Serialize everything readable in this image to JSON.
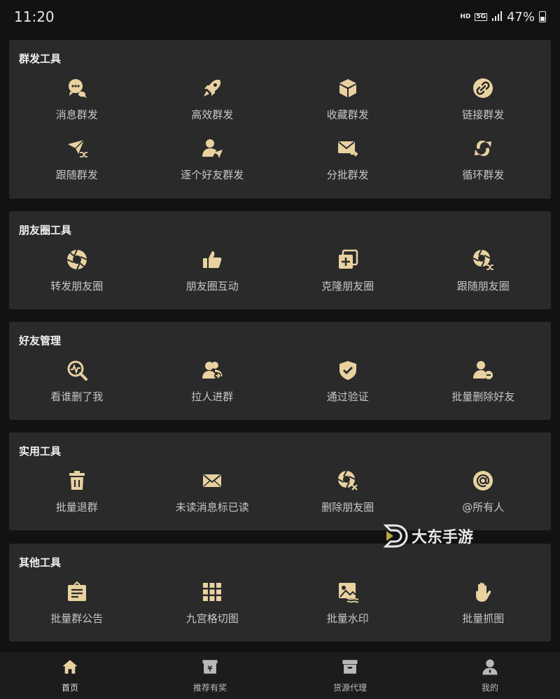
{
  "status": {
    "time": "11:20",
    "hd": "HD",
    "network": "5G",
    "battery": "47%"
  },
  "colors": {
    "accent": "#e9d2a0",
    "card": "#2a2a2b",
    "background": "#121212"
  },
  "sections": [
    {
      "title": "群发工具",
      "items": [
        {
          "label": "消息群发",
          "icon": "chat-bubbles-icon"
        },
        {
          "label": "高效群发",
          "icon": "rocket-icon"
        },
        {
          "label": "收藏群发",
          "icon": "box-icon"
        },
        {
          "label": "链接群发",
          "icon": "link-icon"
        },
        {
          "label": "跟随群发",
          "icon": "paper-plane-shuffle-icon"
        },
        {
          "label": "逐个好友群发",
          "icon": "user-send-icon"
        },
        {
          "label": "分批群发",
          "icon": "mail-forward-icon"
        },
        {
          "label": "循环群发",
          "icon": "loop-arrows-icon"
        }
      ]
    },
    {
      "title": "朋友圈工具",
      "items": [
        {
          "label": "转发朋友圈",
          "icon": "aperture-icon"
        },
        {
          "label": "朋友圈互动",
          "icon": "thumbs-up-icon"
        },
        {
          "label": "克隆朋友圈",
          "icon": "clone-plus-icon"
        },
        {
          "label": "跟随朋友圈",
          "icon": "aperture-shuffle-icon"
        }
      ]
    },
    {
      "title": "好友管理",
      "items": [
        {
          "label": "看谁删了我",
          "icon": "search-pulse-icon"
        },
        {
          "label": "拉人进群",
          "icon": "users-add-icon"
        },
        {
          "label": "通过验证",
          "icon": "shield-check-icon"
        },
        {
          "label": "批量删除好友",
          "icon": "user-remove-icon"
        }
      ]
    },
    {
      "title": "实用工具",
      "items": [
        {
          "label": "批量退群",
          "icon": "trash-icon"
        },
        {
          "label": "未读消息标已读",
          "icon": "envelope-icon"
        },
        {
          "label": "删除朋友圈",
          "icon": "aperture-delete-icon"
        },
        {
          "label": "@所有人",
          "icon": "at-sign-icon"
        }
      ]
    },
    {
      "title": "其他工具",
      "items": [
        {
          "label": "批量群公告",
          "icon": "notice-board-icon"
        },
        {
          "label": "九宫格切图",
          "icon": "grid-nine-icon"
        },
        {
          "label": "批量水印",
          "icon": "image-watermark-icon"
        },
        {
          "label": "批量抓图",
          "icon": "hand-grab-icon"
        }
      ]
    }
  ],
  "watermark": {
    "text": "大东手游"
  },
  "bottom_nav": [
    {
      "label": "首页",
      "icon": "home-icon",
      "active": true
    },
    {
      "label": "推荐有奖",
      "icon": "gift-box-icon",
      "active": false
    },
    {
      "label": "货源代理",
      "icon": "archive-icon",
      "active": false
    },
    {
      "label": "我的",
      "icon": "profile-icon",
      "active": false
    }
  ]
}
